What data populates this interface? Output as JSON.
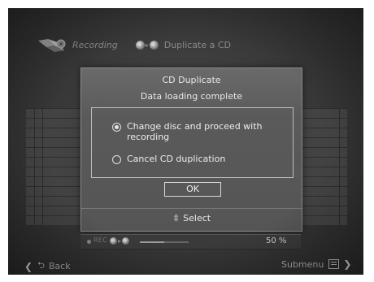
{
  "header": {
    "section_label": "Recording",
    "title": "Duplicate a CD"
  },
  "dialog": {
    "title": "CD Duplicate",
    "message": "Data loading complete",
    "options": [
      {
        "label": "Change disc and proceed with recording",
        "selected": true
      },
      {
        "label": "Cancel CD duplication",
        "selected": false
      }
    ],
    "ok_label": "OK",
    "select_hint": "Select"
  },
  "rec_bar": {
    "label": "REC",
    "progress_percent": 50,
    "percent_text": "50 %"
  },
  "footer": {
    "back_label": "Back",
    "submenu_label": "Submenu"
  },
  "icons": {
    "recording": "recording-logo-icon",
    "discs": "disc-to-disc-icon",
    "select": "up-down-icon",
    "back": "return-arrow-icon",
    "submenu": "submenu-icon"
  }
}
